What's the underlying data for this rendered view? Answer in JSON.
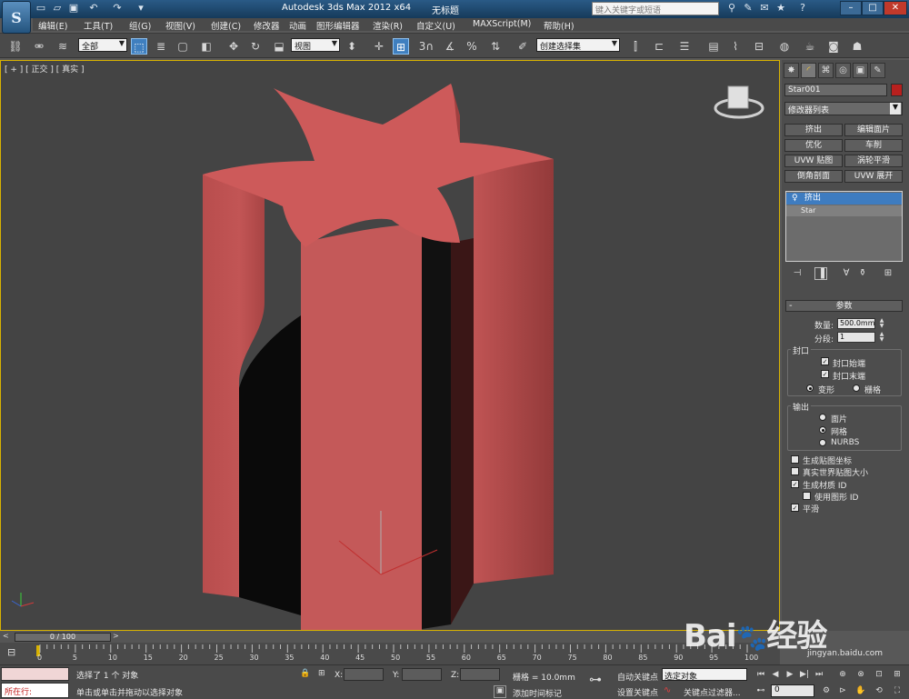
{
  "window": {
    "app_title": "Autodesk 3ds Max  2012 x64",
    "file_name": "无标题",
    "search_placeholder": "键入关键字或短语"
  },
  "menu": [
    "编辑(E)",
    "工具(T)",
    "组(G)",
    "视图(V)",
    "创建(C)",
    "修改器",
    "动画",
    "图形编辑器",
    "渲染(R)",
    "自定义(U)",
    "MAXScript(M)",
    "帮助(H)"
  ],
  "toolbar": {
    "selection_filter": "全部",
    "ref_coord": "视图",
    "named_selection": "创建选择集"
  },
  "viewport": {
    "label": "[ + ] [ 正交 ] [ 真实 ]"
  },
  "command_panel": {
    "object_name": "Star001",
    "object_color": "#b8201e",
    "modifier_list": "修改器列表",
    "modifier_buttons": [
      "挤出",
      "编辑面片",
      "优化",
      "车削",
      "UVW 贴图",
      "涡轮平滑",
      "倒角剖面",
      "UVW 展开"
    ],
    "stack": [
      "挤出",
      "Star"
    ],
    "params": {
      "rollout_title": "参数",
      "amount_label": "数量:",
      "amount_value": "500.0mm",
      "segments_label": "分段:",
      "segments_value": "1",
      "capping_group": "封口",
      "cap_start": "封口始端",
      "cap_end": "封口末端",
      "morph": "变形",
      "grid": "栅格",
      "output_group": "输出",
      "patch": "面片",
      "mesh": "网格",
      "nurbs": "NURBS",
      "gen_map_coords": "生成贴图坐标",
      "real_world_map": "真实世界贴图大小",
      "gen_mat_ids": "生成材质 ID",
      "use_shape_ids": "使用图形 ID",
      "smooth": "平滑"
    }
  },
  "timeline": {
    "frame_range": "0 / 100",
    "ticks": [
      "0",
      "5",
      "10",
      "15",
      "20",
      "25",
      "30",
      "35",
      "40",
      "45",
      "50",
      "55",
      "60",
      "65",
      "70",
      "75",
      "80",
      "85",
      "90",
      "95",
      "100"
    ]
  },
  "status": {
    "maxscript_prompt": "所在行:",
    "selection_status": "选择了 1 个 对象",
    "prompt": "单击或单击并拖动以选择对象",
    "x_label": "X:",
    "y_label": "Y:",
    "z_label": "Z:",
    "grid": "栅格 = 10.0mm",
    "add_time_tag": "添加时间标记",
    "auto_key": "自动关键点",
    "set_key": "设置关键点",
    "selected_dropdown": "选定对象",
    "key_filters": "关键点过滤器...",
    "current_frame": "0"
  },
  "watermark": {
    "brand": "Bai",
    "brand_tail": "经验",
    "url": "jingyan.baidu.com"
  }
}
